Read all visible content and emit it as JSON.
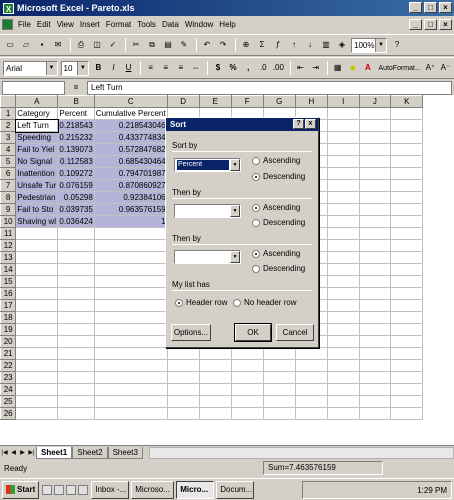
{
  "window": {
    "title": "Microsoft Excel - Pareto.xls",
    "app_icon": "X"
  },
  "menubar": [
    "File",
    "Edit",
    "View",
    "Insert",
    "Format",
    "Tools",
    "Data",
    "Window",
    "Help"
  ],
  "toolbar": {
    "zoom": "100%",
    "font_name": "Arial",
    "font_size": "10",
    "bold": "B",
    "italic": "I",
    "underline": "U",
    "currency": "$",
    "percent": "%",
    "comma": ",",
    "autoformat": "AutoFormat..."
  },
  "formula_bar": {
    "name_box": "",
    "equals": "=",
    "value": "Left Turn"
  },
  "grid": {
    "columns": [
      "A",
      "B",
      "C",
      "D",
      "E",
      "F",
      "G",
      "H",
      "I",
      "J",
      "K"
    ],
    "header_row": [
      "Category",
      "Percent",
      "Cumulative Percent"
    ],
    "rows": [
      [
        "Left Turn",
        "0.218543",
        "0.218543046"
      ],
      [
        "Speeding",
        "0.215232",
        "0.433774834"
      ],
      [
        "Fail to Yiel",
        "0.139073",
        "0.572847682"
      ],
      [
        "No Signal",
        "0.112583",
        "0.685430464"
      ],
      [
        "Inattention",
        "0.109272",
        "0.794701987"
      ],
      [
        "Unsafe Tur",
        "0.076159",
        "0.870860927"
      ],
      [
        "Pedestrian",
        "0.05298",
        "0.92384106"
      ],
      [
        "Fail to Sto",
        "0.039735",
        "0.963576159"
      ],
      [
        "Shaving wl",
        "0.036424",
        "1"
      ]
    ],
    "row_numbers": [
      "1",
      "2",
      "3",
      "4",
      "5",
      "6",
      "7",
      "8",
      "9",
      "10",
      "11",
      "12",
      "13",
      "14",
      "15",
      "16",
      "17",
      "18",
      "19",
      "20",
      "21",
      "22",
      "23",
      "24",
      "25",
      "26"
    ]
  },
  "sheet_tabs": [
    "Sheet1",
    "Sheet2",
    "Sheet3"
  ],
  "status": {
    "left": "Ready",
    "sum": "Sum=7.463576159"
  },
  "taskbar": {
    "start": "Start",
    "buttons": [
      "Inbox -...",
      "Microso...",
      "Micro...",
      "Docum...",
      "Microso..."
    ],
    "clock": "1:29 PM"
  },
  "sort_dialog": {
    "title": "Sort",
    "help": "?",
    "close": "x",
    "sort_by_label": "Sort by",
    "sort_by_value": "Percent",
    "then_by_1_label": "Then by",
    "then_by_2_label": "Then by",
    "ascending": "Ascending",
    "descending": "Descending",
    "list_has_label": "My list has",
    "header_row": "Header row",
    "no_header_row": "No header row",
    "options_button": "Options...",
    "ok_button": "OK",
    "cancel_button": "Cancel",
    "sort_by_order": "descending",
    "then_by_1_order": "ascending",
    "then_by_2_order": "ascending",
    "list_has": "header"
  }
}
